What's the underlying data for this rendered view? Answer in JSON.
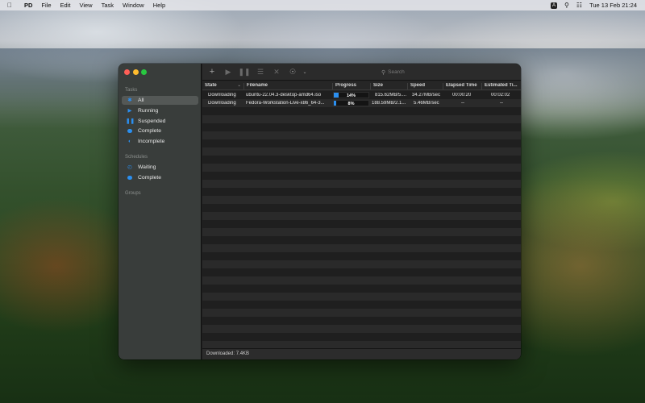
{
  "menubar": {
    "app_name": "PD",
    "menus": [
      "File",
      "Edit",
      "View",
      "Task",
      "Window",
      "Help"
    ],
    "input_badge": "A",
    "clock": "Tue 13 Feb  21:24"
  },
  "toolbar": {
    "search_placeholder": "Search"
  },
  "sidebar": {
    "tasks_heading": "Tasks",
    "task_items": [
      {
        "label": "All",
        "icon": "asterisk-icon",
        "selected": true
      },
      {
        "label": "Running",
        "icon": "play-icon"
      },
      {
        "label": "Suspended",
        "icon": "pause-icon"
      },
      {
        "label": "Complete",
        "icon": "filled-circle-icon"
      },
      {
        "label": "Incomplete",
        "icon": "half-circle-icon"
      }
    ],
    "schedules_heading": "Schedules",
    "schedule_items": [
      {
        "label": "Waiting",
        "icon": "clock-icon"
      },
      {
        "label": "Complete",
        "icon": "filled-circle-icon"
      }
    ],
    "groups_heading": "Groups"
  },
  "table": {
    "columns": [
      "State",
      "Filename",
      "Progress",
      "Size",
      "Speed",
      "Elapsed Time",
      "Estimated Ti..."
    ],
    "rows": [
      {
        "state": "Downloading",
        "filename": "ubuntu-22.04.3-desktop-amd64.iso",
        "progress": 0.14,
        "progress_label": "14%",
        "size": "815.62MB/5....",
        "speed": "34.27MB/sec",
        "elapsed": "00:00:20",
        "estimated": "00:02:02"
      },
      {
        "state": "Downloading",
        "filename": "Fedora-Workstation-Live-x86_64-3...",
        "progress": 0.08,
        "progress_label": "8%",
        "size": "188.59MB/2.1...",
        "speed": "5.46MB/sec",
        "elapsed": "--",
        "estimated": "--"
      }
    ]
  },
  "statusbar": {
    "text": "Downloaded: 7.4KB"
  },
  "colors": {
    "accent": "#2b8ff0",
    "close": "#ff5f57",
    "minimize": "#febc2e",
    "zoom": "#28c840"
  }
}
